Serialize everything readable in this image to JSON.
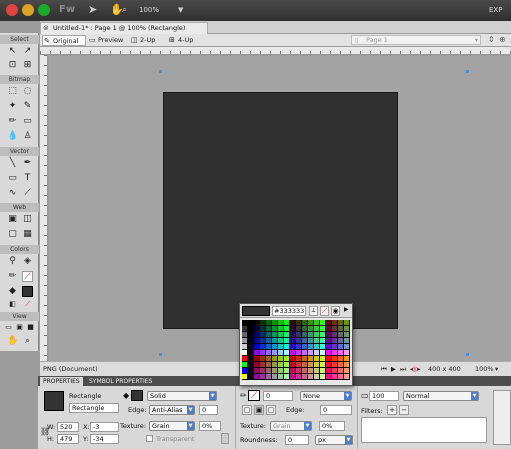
{
  "titlebar": {
    "app_logo": "Fw",
    "zoom": "100%",
    "workspace": "EXP",
    "icons": [
      "fireworks-logo",
      "pointer-icon",
      "hand-icon",
      "zoom-icon"
    ]
  },
  "document": {
    "tab_title": "Untitled-1* : Page 1 @ 100% (Rectangle)"
  },
  "view_tabs": [
    "Original",
    "Preview",
    "2-Up",
    "4-Up"
  ],
  "page_selector": "Page 1",
  "tools": {
    "sections": [
      "Select",
      "Bitmap",
      "Vector",
      "Web",
      "Colors",
      "View"
    ]
  },
  "status": {
    "doc_type": "PNG (Document)",
    "canvas_size": "400 x 400",
    "zoom": "100%"
  },
  "props": {
    "tabs": [
      "PROPERTIES",
      "SYMBOL PROPERTIES"
    ],
    "object_type": "Rectangle",
    "object_name": "Rectangle",
    "w_label": "W:",
    "w": "520",
    "h_label": "H:",
    "h": "479",
    "x_label": "X:",
    "x": "-3",
    "y_label": "Y:",
    "y": "-34",
    "fill": "Solid",
    "edge_label": "Edge:",
    "edge": "Anti-Alias",
    "edge_value": "0",
    "texture_label": "Texture:",
    "texture": "Grain",
    "texture_value": "0%",
    "transparent": "Transparent",
    "stroke_size": "0",
    "stroke_type": "None",
    "stroke_edge_label": "Edge:",
    "stroke_edge": "0",
    "stroke_texture_label": "Texture:",
    "stroke_texture": "Grain",
    "stroke_texture_value": "0%",
    "roundness_label": "Roundness:",
    "roundness": "0",
    "roundness_unit": "px",
    "opacity": "100",
    "blend": "Normal",
    "filters_label": "Filters:"
  },
  "swatches": {
    "hex": "#333333",
    "current_color": "#333333"
  }
}
